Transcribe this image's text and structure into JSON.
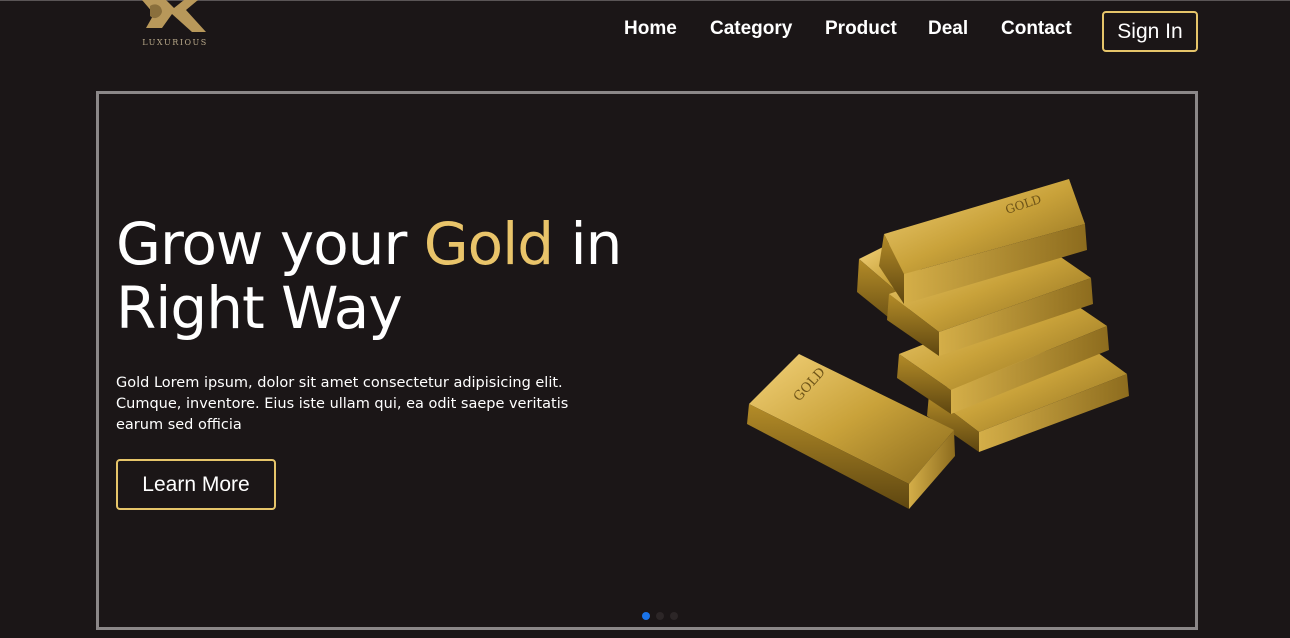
{
  "brand": {
    "logo_text": "LUXURIOUS",
    "accent_color": "#e9c46a"
  },
  "nav": {
    "items": [
      {
        "label": "Home"
      },
      {
        "label": "Category"
      },
      {
        "label": "Product"
      },
      {
        "label": "Deal"
      },
      {
        "label": "Contact"
      }
    ],
    "sign_in_label": "Sign In"
  },
  "hero": {
    "title_part1": "Grow your ",
    "title_highlight": "Gold",
    "title_part2": " in Right Way",
    "description": "Gold Lorem ipsum, dolor sit amet consectetur adipisicing elit. Cumque, inventore. Eius iste ullam qui, ea odit saepe veritatis earum sed officia",
    "cta_label": "Learn More",
    "image_icon": "gold-bars-image",
    "bar_stamp": "GOLD",
    "slides": {
      "count": 3,
      "active": 1,
      "active_color": "#1a73e8",
      "inactive_color": "#2c2627"
    }
  }
}
